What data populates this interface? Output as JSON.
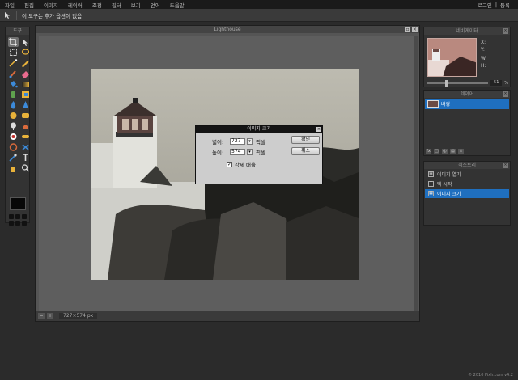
{
  "menu": {
    "items": [
      "파일",
      "편집",
      "이미지",
      "레이어",
      "조정",
      "필터",
      "보기",
      "언어",
      "도움말"
    ],
    "login": "로그인",
    "separator": "|",
    "register": "등록"
  },
  "options_bar": {
    "tool_icon": "move-arrow-icon",
    "message": "이 도구는 추가 옵션이 없음"
  },
  "toolbox": {
    "title": "도구"
  },
  "document": {
    "title": "Lighthouse",
    "min_glyph": "▫",
    "close_glyph": "×",
    "dimensions": "727×574 px",
    "zoom_out_glyph": "−",
    "zoom_in_glyph": "+"
  },
  "dialog": {
    "title": "이미지 크기",
    "close_glyph": "×",
    "width_label": "넓이:",
    "width_value": "727",
    "width_unit_glyph": "▾",
    "width_unit": "픽셀",
    "height_label": "높이:",
    "height_value": "574",
    "height_unit_glyph": "▾",
    "height_unit": "픽셀",
    "constrain_checked_glyph": "✓",
    "constrain_label": "강제 배율",
    "ok_button": "확인",
    "cancel_button": "취소"
  },
  "navigator": {
    "title": "네비게이터",
    "close_glyph": "×",
    "x_label": "X:",
    "y_label": "Y:",
    "w_label": "W:",
    "h_label": "H:",
    "zoom_value": "51",
    "zoom_unit": "%"
  },
  "layers": {
    "title": "레이어",
    "close_glyph": "×",
    "layer_name": "배경",
    "footer_glyphs": [
      "fx",
      "□",
      "◐",
      "▤",
      "✕"
    ]
  },
  "history": {
    "title": "히스토리",
    "close_glyph": "×",
    "items": [
      {
        "label": "이미지 열기",
        "icon": "open-image-icon",
        "glyph": "▣"
      },
      {
        "label": "텍 시작",
        "icon": "text-icon",
        "glyph": "T"
      },
      {
        "label": "이미지 크기",
        "icon": "resize-icon",
        "glyph": "▦"
      }
    ]
  },
  "footer": {
    "text": "© 2010 Pixlr.com v4.2"
  },
  "colors": {
    "selection": "#1f6fbf",
    "dialog_bg": "#cdcdcd"
  }
}
